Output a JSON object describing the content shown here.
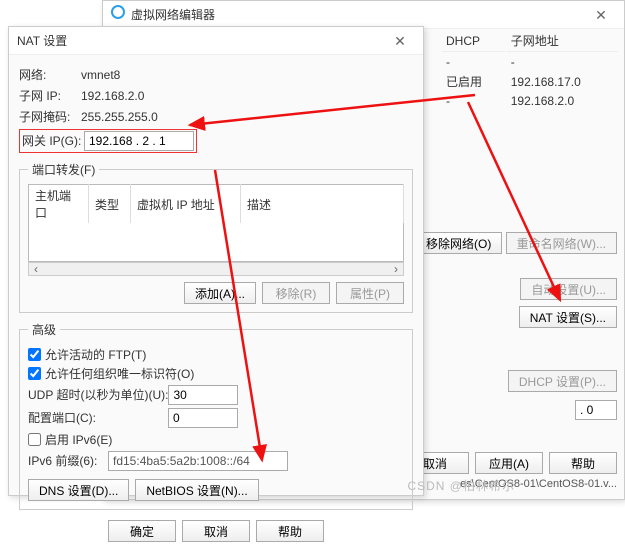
{
  "editor": {
    "title": "虚拟网络编辑器",
    "cols": {
      "dhcp": "DHCP",
      "subnet": "子网地址"
    },
    "rows": [
      {
        "dhcp": "-",
        "subnet": "-"
      },
      {
        "dhcp": "已启用",
        "subnet": "192.168.17.0"
      },
      {
        "dhcp": "-",
        "subnet": "192.168.2.0"
      }
    ],
    "remove_net": "移除网络(O)",
    "rename_net": "重命名网络(W)...",
    "auto_settings": "自动设置(U)...",
    "nat_settings": "NAT 设置(S)...",
    "dhcp_settings": "DHCP 设置(P)...",
    "subnet_suffix": ". 0",
    "btn_ok": "确定",
    "btn_cancel": "取消",
    "btn_apply": "应用(A)",
    "btn_help": "帮助",
    "path_fragment": "es\\CentOS8-01\\CentOS8-01.v..."
  },
  "nat": {
    "title": "NAT 设置",
    "net_label": "网络:",
    "net_value": "vmnet8",
    "subnet_ip_label": "子网 IP:",
    "subnet_ip_value": "192.168.2.0",
    "mask_label": "子网掩码:",
    "mask_value": "255.255.255.0",
    "gateway_label": "网关 IP(G):",
    "gateway_value": "192.168 . 2 . 1",
    "port_forward": "端口转发(F)",
    "pf_cols": {
      "host_port": "主机端口",
      "type": "类型",
      "vm_ip": "虚拟机 IP 地址",
      "desc": "描述"
    },
    "add": "添加(A)...",
    "remove": "移除(R)",
    "props": "属性(P)",
    "advanced": "高级",
    "allow_ftp": "允许活动的 FTP(T)",
    "allow_any_oui": "允许任何组织唯一标识符(O)",
    "udp_timeout_label": "UDP 超时(以秒为单位)(U):",
    "udp_timeout_value": "30",
    "config_port_label": "配置端口(C):",
    "config_port_value": "0",
    "enable_ipv6": "启用 IPv6(E)",
    "ipv6_prefix_label": "IPv6 前缀(6):",
    "ipv6_prefix_value": "fd15:4ba5:5a2b:1008::/64",
    "dns_settings": "DNS 设置(D)...",
    "netbios_settings": "NetBIOS 设置(N)...",
    "ok": "确定",
    "cancel": "取消",
    "help": "帮助"
  },
  "watermark": "CSDN @柏林希尔"
}
